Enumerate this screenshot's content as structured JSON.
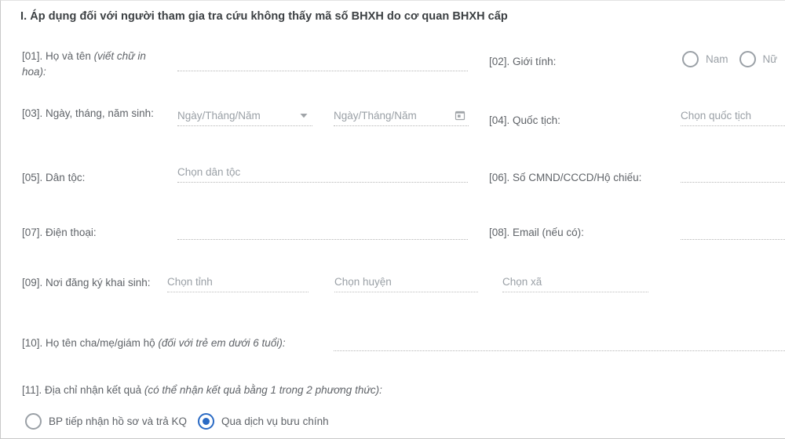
{
  "section": {
    "heading": "I. Áp dụng đối với người tham gia tra cứu không thấy mã số BHXH do cơ quan BHXH cấp"
  },
  "fields": {
    "f01": {
      "number": "[01].",
      "label": "Họ và tên",
      "note": "(viết chữ in hoa):",
      "value": "",
      "placeholder": ""
    },
    "f02": {
      "number": "[02].",
      "label": "Giới tính:",
      "options": [
        {
          "label": "Nam",
          "checked": false
        },
        {
          "label": "Nữ",
          "checked": false
        }
      ]
    },
    "f03": {
      "number": "[03].",
      "label": "Ngày, tháng, năm sinh:",
      "input_a": {
        "placeholder": "Ngày/Tháng/Năm",
        "value": "",
        "icon": "chevron-down-icon"
      },
      "input_b": {
        "placeholder": "Ngày/Tháng/Năm",
        "value": "",
        "icon": "calendar-icon"
      }
    },
    "f04": {
      "number": "[04].",
      "label": "Quốc tịch:",
      "placeholder": "Chọn quốc tịch",
      "value": ""
    },
    "f05": {
      "number": "[05].",
      "label": "Dân tộc:",
      "placeholder": "Chọn dân tộc",
      "value": ""
    },
    "f06": {
      "number": "[06].",
      "label": "Số CMND/CCCD/Hộ chiếu:",
      "placeholder": "",
      "value": ""
    },
    "f07": {
      "number": "[07].",
      "label": "Điện thoại:",
      "placeholder": "",
      "value": ""
    },
    "f08": {
      "number": "[08].",
      "label": "Email (nếu có):",
      "placeholder": "",
      "value": ""
    },
    "f09": {
      "number": "[09].",
      "label": "Nơi đăng ký khai sinh:",
      "province": {
        "placeholder": "Chọn tỉnh",
        "value": ""
      },
      "district": {
        "placeholder": "Chọn huyện",
        "value": ""
      },
      "ward": {
        "placeholder": "Chọn xã",
        "value": ""
      }
    },
    "f10": {
      "number": "[10].",
      "label": "Họ tên cha/mẹ/giám hộ",
      "note": "(đối với trẻ em dưới 6 tuổi):",
      "placeholder": "",
      "value": ""
    },
    "f11": {
      "number": "[11].",
      "label": "Địa chỉ nhận kết quả",
      "note": "(có thể nhận kết quả bằng 1 trong 2 phương thức):",
      "options": [
        {
          "label": "BP tiếp nhận hồ sơ và trả KQ",
          "checked": false
        },
        {
          "label": "Qua dịch vụ bưu chính",
          "checked": true
        }
      ]
    }
  },
  "colors": {
    "accent": "#2a6ac4",
    "label_text": "#5f6368",
    "heading_text": "#3c4043",
    "placeholder": "#9aa0a6",
    "underline": "#b6b6b6",
    "border": "#c9c9c9"
  }
}
